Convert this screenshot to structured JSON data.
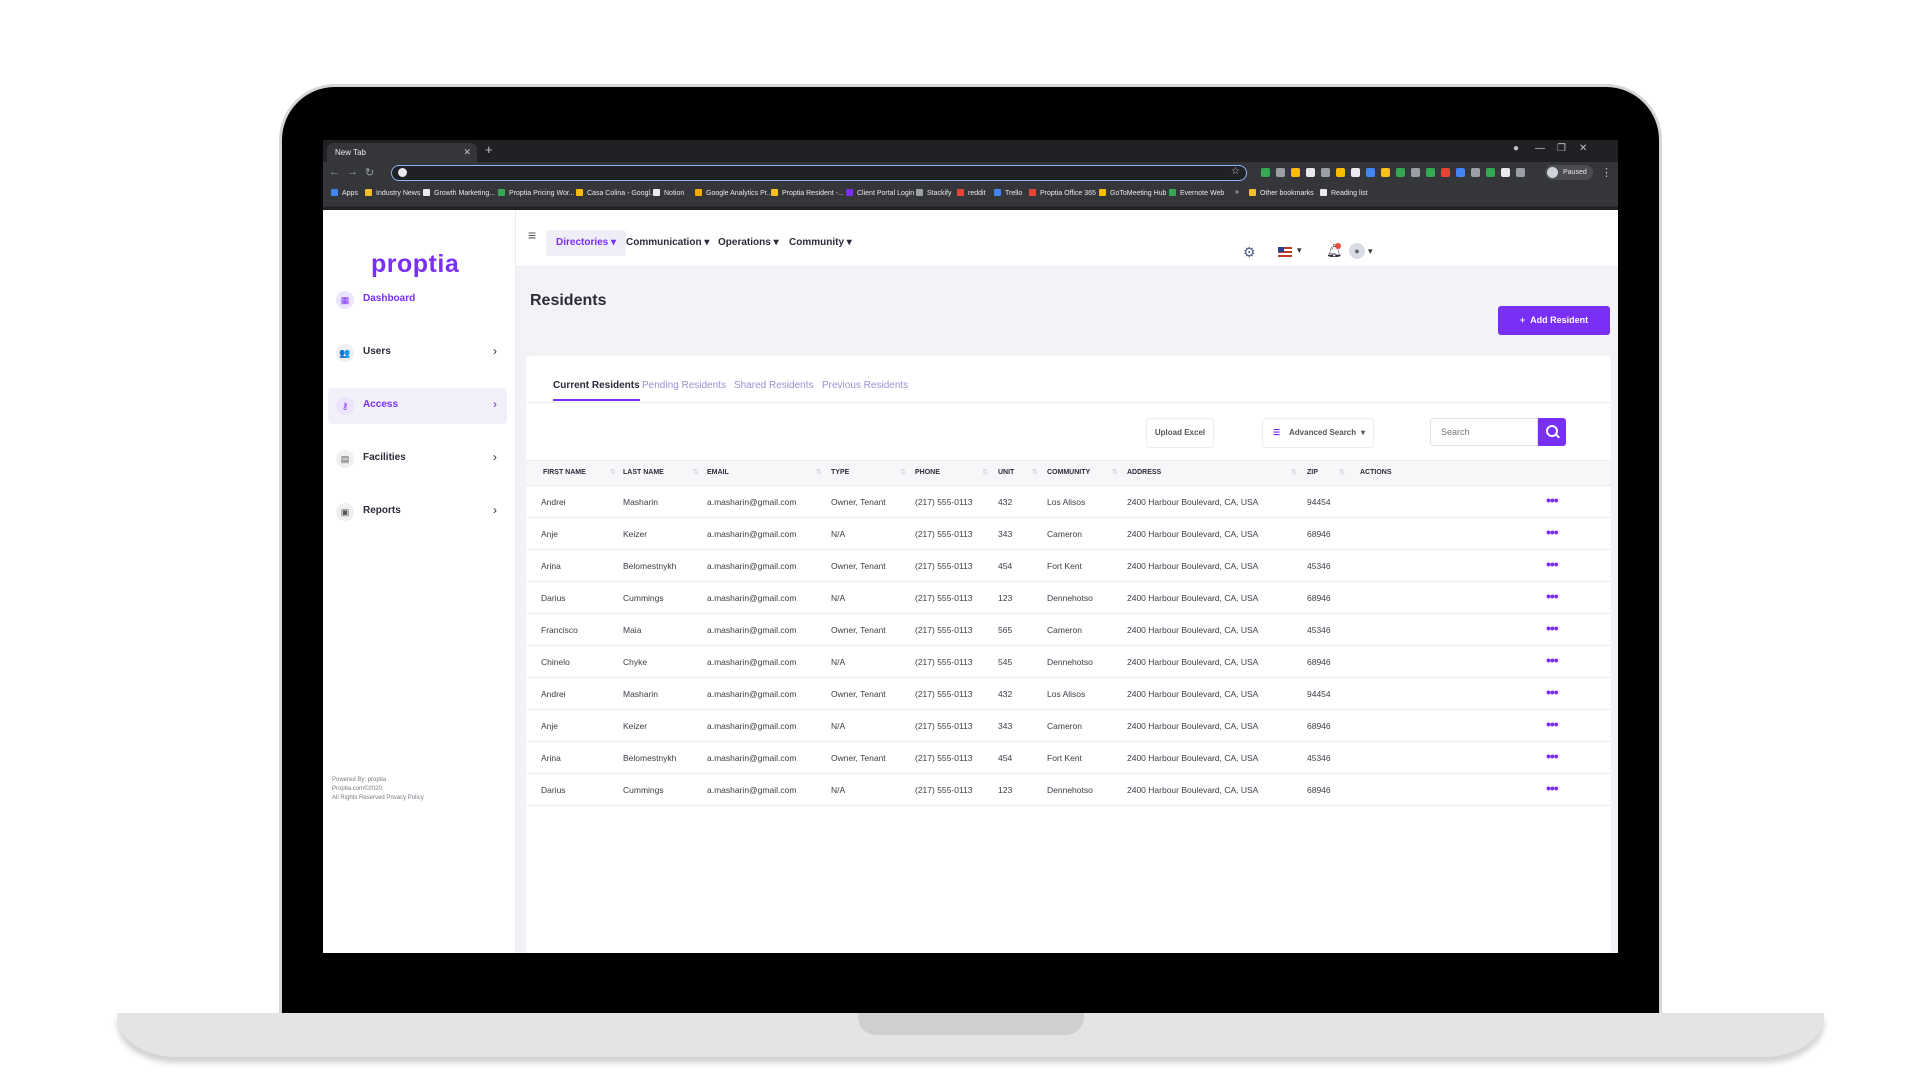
{
  "browser": {
    "tab_title": "New Tab",
    "tab_close": "✕",
    "new_tab": "+",
    "profile_status": "Paused",
    "bookmarks": [
      "Apps",
      "Industry News",
      "Growth Marketing...",
      "Proptia Pricing Wor...",
      "Casa Colina - Googl...",
      "Notion",
      "Google Analytics Pr...",
      "Proptia Resident -...",
      "Client Portal Login",
      "Stackify",
      "reddit",
      "Trello",
      "Proptia Office 365",
      "GoToMeeting Hub",
      "Evernote Web",
      "»",
      "Other bookmarks",
      "Reading list"
    ]
  },
  "sidebar": {
    "logo": "proptia",
    "items": [
      {
        "label": "Dashboard",
        "icon": "dashboard-icon"
      },
      {
        "label": "Users",
        "icon": "users-icon"
      },
      {
        "label": "Access",
        "icon": "key-icon"
      },
      {
        "label": "Facilities",
        "icon": "building-icon"
      },
      {
        "label": "Reports",
        "icon": "clipboard-icon"
      }
    ],
    "footer": [
      "Powered By: proptia",
      "Proptia.com©2020.",
      "All Rights Reserved Privacy Policy"
    ]
  },
  "topnav": {
    "menus": [
      "Directories",
      "Communication",
      "Operations",
      "Community"
    ]
  },
  "page": {
    "title": "Residents",
    "add_button": "Add Resident"
  },
  "tabs": [
    "Current Residents",
    "Pending Residents",
    "Shared Residents",
    "Previous Residents"
  ],
  "toolbar": {
    "upload": "Upload Excel",
    "advanced": "Advanced Search",
    "search_placeholder": "Search"
  },
  "table": {
    "columns": [
      "FIRST NAME",
      "LAST NAME",
      "EMAIL",
      "TYPE",
      "PHONE",
      "UNIT",
      "COMMUNITY",
      "ADDRESS",
      "ZIP",
      "ACTIONS"
    ],
    "rows": [
      [
        "Andrei",
        "Masharin",
        "a.masharin@gmail.com",
        "Owner, Tenant",
        "(217) 555-0113",
        "432",
        "Los Alisos",
        "2400 Harbour Boulevard, CA, USA",
        "94454"
      ],
      [
        "Anje",
        "Keizer",
        "a.masharin@gmail.com",
        "N/A",
        "(217) 555-0113",
        "343",
        "Cameron",
        "2400 Harbour Boulevard, CA, USA",
        "68946"
      ],
      [
        "Arina",
        "Belomestnykh",
        "a.masharin@gmail.com",
        "Owner, Tenant",
        "(217) 555-0113",
        "454",
        "Fort Kent",
        "2400 Harbour Boulevard, CA, USA",
        "45346"
      ],
      [
        "Darius",
        "Cummings",
        "a.masharin@gmail.com",
        "N/A",
        "(217) 555-0113",
        "123",
        "Dennehotso",
        "2400 Harbour Boulevard, CA, USA",
        "68946"
      ],
      [
        "Francisco",
        "Maia",
        "a.masharin@gmail.com",
        "Owner, Tenant",
        "(217) 555-0113",
        "565",
        "Cameron",
        "2400 Harbour Boulevard, CA, USA",
        "45346"
      ],
      [
        "Chinelo",
        "Chyke",
        "a.masharin@gmail.com",
        "N/A",
        "(217) 555-0113",
        "545",
        "Dennehotso",
        "2400 Harbour Boulevard, CA, USA",
        "68946"
      ],
      [
        "Andrei",
        "Masharin",
        "a.masharin@gmail.com",
        "Owner, Tenant",
        "(217) 555-0113",
        "432",
        "Los Alisos",
        "2400 Harbour Boulevard, CA, USA",
        "94454"
      ],
      [
        "Anje",
        "Keizer",
        "a.masharin@gmail.com",
        "N/A",
        "(217) 555-0113",
        "343",
        "Cameron",
        "2400 Harbour Boulevard, CA, USA",
        "68946"
      ],
      [
        "Arina",
        "Belomestnykh",
        "a.masharin@gmail.com",
        "Owner, Tenant",
        "(217) 555-0113",
        "454",
        "Fort Kent",
        "2400 Harbour Boulevard, CA, USA",
        "45346"
      ],
      [
        "Darius",
        "Cummings",
        "a.masharin@gmail.com",
        "N/A",
        "(217) 555-0113",
        "123",
        "Dennehotso",
        "2400 Harbour Boulevard, CA, USA",
        "68946"
      ]
    ]
  },
  "colors": {
    "accent": "#7a2ff7",
    "background": "#f3f3f7"
  }
}
